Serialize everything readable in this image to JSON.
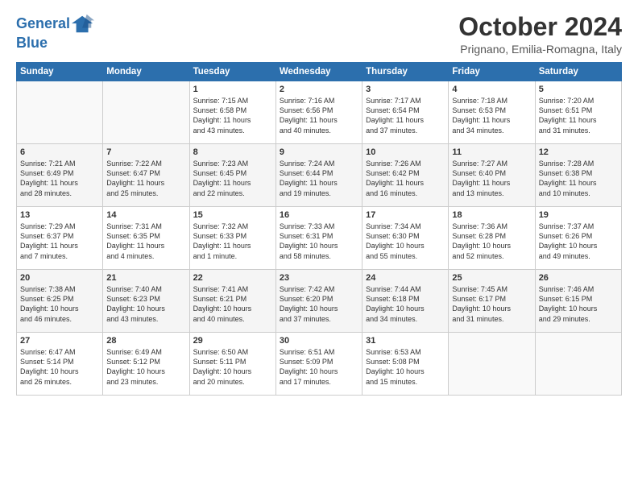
{
  "logo": {
    "line1": "General",
    "line2": "Blue"
  },
  "title": "October 2024",
  "location": "Prignano, Emilia-Romagna, Italy",
  "header_days": [
    "Sunday",
    "Monday",
    "Tuesday",
    "Wednesday",
    "Thursday",
    "Friday",
    "Saturday"
  ],
  "weeks": [
    [
      {
        "day": "",
        "text": ""
      },
      {
        "day": "",
        "text": ""
      },
      {
        "day": "1",
        "text": "Sunrise: 7:15 AM\nSunset: 6:58 PM\nDaylight: 11 hours\nand 43 minutes."
      },
      {
        "day": "2",
        "text": "Sunrise: 7:16 AM\nSunset: 6:56 PM\nDaylight: 11 hours\nand 40 minutes."
      },
      {
        "day": "3",
        "text": "Sunrise: 7:17 AM\nSunset: 6:54 PM\nDaylight: 11 hours\nand 37 minutes."
      },
      {
        "day": "4",
        "text": "Sunrise: 7:18 AM\nSunset: 6:53 PM\nDaylight: 11 hours\nand 34 minutes."
      },
      {
        "day": "5",
        "text": "Sunrise: 7:20 AM\nSunset: 6:51 PM\nDaylight: 11 hours\nand 31 minutes."
      }
    ],
    [
      {
        "day": "6",
        "text": "Sunrise: 7:21 AM\nSunset: 6:49 PM\nDaylight: 11 hours\nand 28 minutes."
      },
      {
        "day": "7",
        "text": "Sunrise: 7:22 AM\nSunset: 6:47 PM\nDaylight: 11 hours\nand 25 minutes."
      },
      {
        "day": "8",
        "text": "Sunrise: 7:23 AM\nSunset: 6:45 PM\nDaylight: 11 hours\nand 22 minutes."
      },
      {
        "day": "9",
        "text": "Sunrise: 7:24 AM\nSunset: 6:44 PM\nDaylight: 11 hours\nand 19 minutes."
      },
      {
        "day": "10",
        "text": "Sunrise: 7:26 AM\nSunset: 6:42 PM\nDaylight: 11 hours\nand 16 minutes."
      },
      {
        "day": "11",
        "text": "Sunrise: 7:27 AM\nSunset: 6:40 PM\nDaylight: 11 hours\nand 13 minutes."
      },
      {
        "day": "12",
        "text": "Sunrise: 7:28 AM\nSunset: 6:38 PM\nDaylight: 11 hours\nand 10 minutes."
      }
    ],
    [
      {
        "day": "13",
        "text": "Sunrise: 7:29 AM\nSunset: 6:37 PM\nDaylight: 11 hours\nand 7 minutes."
      },
      {
        "day": "14",
        "text": "Sunrise: 7:31 AM\nSunset: 6:35 PM\nDaylight: 11 hours\nand 4 minutes."
      },
      {
        "day": "15",
        "text": "Sunrise: 7:32 AM\nSunset: 6:33 PM\nDaylight: 11 hours\nand 1 minute."
      },
      {
        "day": "16",
        "text": "Sunrise: 7:33 AM\nSunset: 6:31 PM\nDaylight: 10 hours\nand 58 minutes."
      },
      {
        "day": "17",
        "text": "Sunrise: 7:34 AM\nSunset: 6:30 PM\nDaylight: 10 hours\nand 55 minutes."
      },
      {
        "day": "18",
        "text": "Sunrise: 7:36 AM\nSunset: 6:28 PM\nDaylight: 10 hours\nand 52 minutes."
      },
      {
        "day": "19",
        "text": "Sunrise: 7:37 AM\nSunset: 6:26 PM\nDaylight: 10 hours\nand 49 minutes."
      }
    ],
    [
      {
        "day": "20",
        "text": "Sunrise: 7:38 AM\nSunset: 6:25 PM\nDaylight: 10 hours\nand 46 minutes."
      },
      {
        "day": "21",
        "text": "Sunrise: 7:40 AM\nSunset: 6:23 PM\nDaylight: 10 hours\nand 43 minutes."
      },
      {
        "day": "22",
        "text": "Sunrise: 7:41 AM\nSunset: 6:21 PM\nDaylight: 10 hours\nand 40 minutes."
      },
      {
        "day": "23",
        "text": "Sunrise: 7:42 AM\nSunset: 6:20 PM\nDaylight: 10 hours\nand 37 minutes."
      },
      {
        "day": "24",
        "text": "Sunrise: 7:44 AM\nSunset: 6:18 PM\nDaylight: 10 hours\nand 34 minutes."
      },
      {
        "day": "25",
        "text": "Sunrise: 7:45 AM\nSunset: 6:17 PM\nDaylight: 10 hours\nand 31 minutes."
      },
      {
        "day": "26",
        "text": "Sunrise: 7:46 AM\nSunset: 6:15 PM\nDaylight: 10 hours\nand 29 minutes."
      }
    ],
    [
      {
        "day": "27",
        "text": "Sunrise: 6:47 AM\nSunset: 5:14 PM\nDaylight: 10 hours\nand 26 minutes."
      },
      {
        "day": "28",
        "text": "Sunrise: 6:49 AM\nSunset: 5:12 PM\nDaylight: 10 hours\nand 23 minutes."
      },
      {
        "day": "29",
        "text": "Sunrise: 6:50 AM\nSunset: 5:11 PM\nDaylight: 10 hours\nand 20 minutes."
      },
      {
        "day": "30",
        "text": "Sunrise: 6:51 AM\nSunset: 5:09 PM\nDaylight: 10 hours\nand 17 minutes."
      },
      {
        "day": "31",
        "text": "Sunrise: 6:53 AM\nSunset: 5:08 PM\nDaylight: 10 hours\nand 15 minutes."
      },
      {
        "day": "",
        "text": ""
      },
      {
        "day": "",
        "text": ""
      }
    ]
  ]
}
